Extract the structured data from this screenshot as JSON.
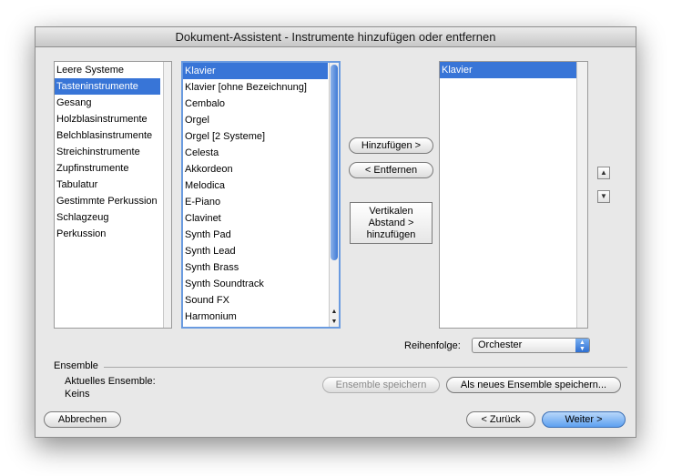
{
  "window": {
    "title": "Dokument-Assistent - Instrumente hinzufügen oder entfernen"
  },
  "families": {
    "items": [
      "Leere Systeme",
      "Tasteninstrumente",
      "Gesang",
      "Holzblasinstrumente",
      "Belchblasinstrumente",
      "Streichinstrumente",
      "Zupfinstrumente",
      "Tabulatur",
      "Gestimmte Perkussion",
      "Schlagzeug",
      "Perkussion"
    ],
    "selected_index": 1
  },
  "instruments": {
    "items": [
      "Klavier",
      "Klavier [ohne Bezeichnung]",
      "Cembalo",
      "Orgel",
      "Orgel [2 Systeme]",
      "Celesta",
      "Akkordeon",
      "Melodica",
      "E-Piano",
      "Clavinet",
      "Synth Pad",
      "Synth Lead",
      "Synth Brass",
      "Synth Soundtrack",
      "Sound FX",
      "Harmonium"
    ],
    "selected_index": 0,
    "scroll_position": 0.0
  },
  "score": {
    "items": [
      "Klavier"
    ],
    "selected_index": 0
  },
  "buttons": {
    "add": "Hinzufügen >",
    "remove": "< Entfernen",
    "add_spacing": "Vertikalen Abstand > hinzufügen",
    "save_ensemble": "Ensemble speichern",
    "save_new_ensemble": "Als neues Ensemble speichern...",
    "cancel": "Abbrechen",
    "back": "< Zurück",
    "next": "Weiter >"
  },
  "order": {
    "label": "Reihenfolge:",
    "value": "Orchester"
  },
  "ensemble": {
    "section_label": "Ensemble",
    "current_label": "Aktuelles Ensemble:",
    "current_value": "Keins"
  },
  "icons": {
    "move_up": "chevron-up-icon",
    "move_down": "chevron-down-icon",
    "scroll_up": "triangle-up-icon",
    "scroll_down": "triangle-down-icon",
    "popup": "updown-arrows-icon"
  },
  "colors": {
    "selection": "#3875d7",
    "default_button": "#5da0f0"
  }
}
